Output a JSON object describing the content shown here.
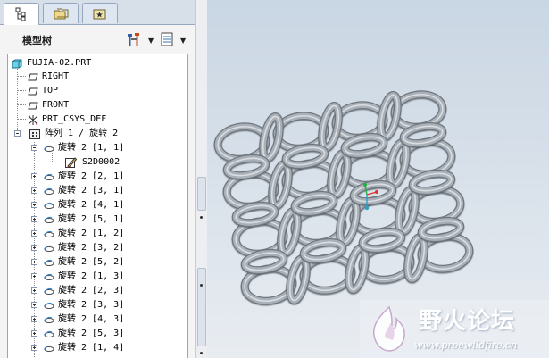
{
  "navigator": {
    "tabs": [
      {
        "name": "model-tree",
        "icon": "model-tree-icon",
        "active": true
      },
      {
        "name": "folder-browser",
        "icon": "folder-icon",
        "active": false
      },
      {
        "name": "favorites",
        "icon": "favorites-icon",
        "active": false
      }
    ],
    "tree_title": "模型树",
    "settings_icon": "tools-icon",
    "show_icon": "list-icon"
  },
  "tree": {
    "root": "FUJIA-02.PRT",
    "datums": [
      "RIGHT",
      "TOP",
      "FRONT"
    ],
    "csys": "PRT_CSYS_DEF",
    "pattern": "阵列 1 / 旋转 2",
    "first_member": "旋转 2 [1, 1]",
    "sketch": "S2D0002",
    "members": [
      "旋转 2 [2, 1]",
      "旋转 2 [3, 1]",
      "旋转 2 [4, 1]",
      "旋转 2 [5, 1]",
      "旋转 2 [1, 2]",
      "旋转 2 [3, 2]",
      "旋转 2 [5, 2]",
      "旋转 2 [1, 3]",
      "旋转 2 [2, 3]",
      "旋转 2 [3, 3]",
      "旋转 2 [4, 3]",
      "旋转 2 [5, 3]",
      "旋转 2 [1, 4]"
    ]
  },
  "watermark": {
    "title": "野火论坛",
    "url": "www.proewildfire.cn"
  },
  "colors": {
    "ring": "#a9b0b8",
    "viewport_top": "#c9d6e3",
    "viewport_bottom": "#e8ecf1",
    "csys_x": "#e03030",
    "csys_y": "#20b040",
    "csys_z": "#2aa0c8"
  }
}
